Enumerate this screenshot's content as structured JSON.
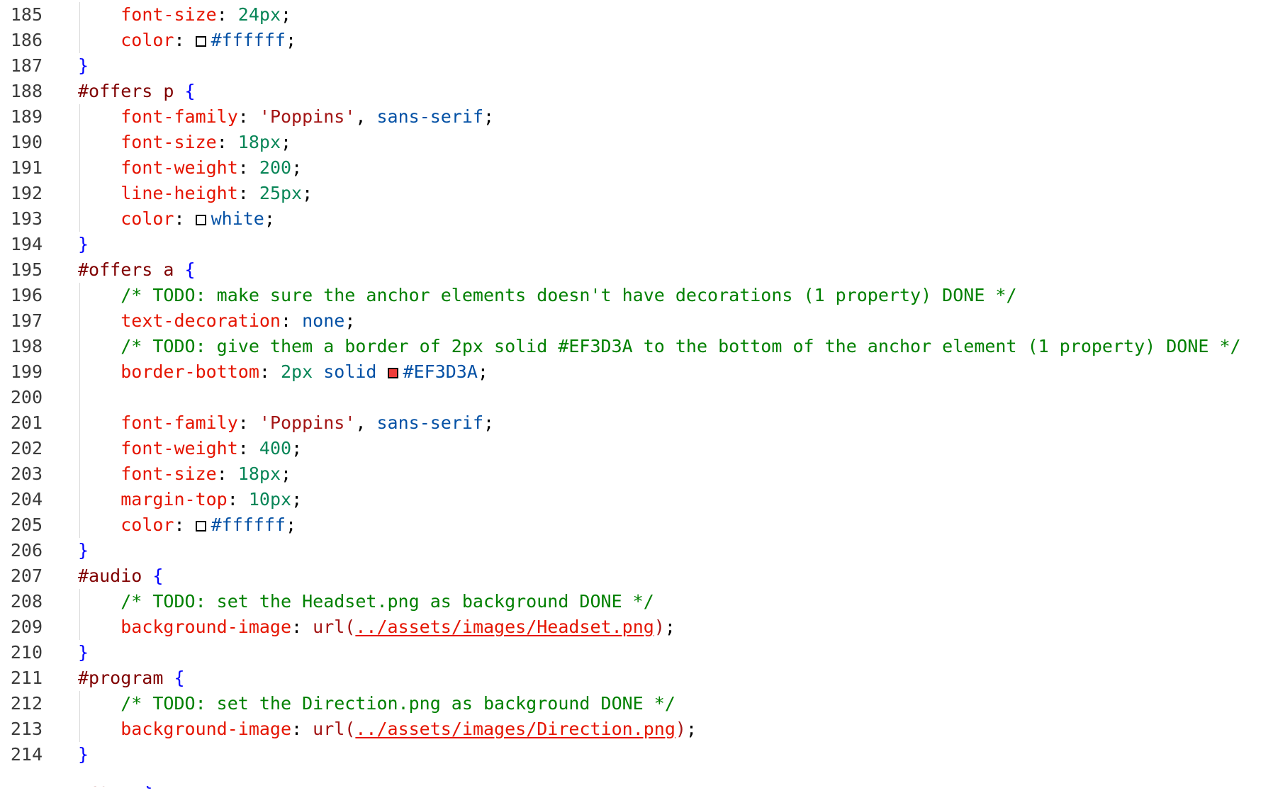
{
  "editor": {
    "lines": [
      {
        "number": "185",
        "indent": "    ",
        "tokens": [
          {
            "t": "font-size",
            "c": "prop"
          },
          {
            "t": ": ",
            "c": "punc"
          },
          {
            "t": "24px",
            "c": "num"
          },
          {
            "t": ";",
            "c": "punc"
          }
        ]
      },
      {
        "number": "186",
        "indent": "    ",
        "tokens": [
          {
            "t": "color",
            "c": "prop"
          },
          {
            "t": ": ",
            "c": "punc"
          },
          {
            "swatch": "#ffffff",
            "c": "swatch"
          },
          {
            "t": "#ffffff",
            "c": "kw"
          },
          {
            "t": ";",
            "c": "punc"
          }
        ]
      },
      {
        "number": "187",
        "indent": "",
        "tokens": [
          {
            "t": "}",
            "c": "brace"
          }
        ]
      },
      {
        "number": "188",
        "indent": "",
        "tokens": [
          {
            "t": "#offers p ",
            "c": "sel"
          },
          {
            "t": "{",
            "c": "brace"
          }
        ]
      },
      {
        "number": "189",
        "indent": "    ",
        "tokens": [
          {
            "t": "font-family",
            "c": "prop"
          },
          {
            "t": ": ",
            "c": "punc"
          },
          {
            "t": "'Poppins'",
            "c": "str"
          },
          {
            "t": ", ",
            "c": "punc"
          },
          {
            "t": "sans-serif",
            "c": "kw"
          },
          {
            "t": ";",
            "c": "punc"
          }
        ]
      },
      {
        "number": "190",
        "indent": "    ",
        "tokens": [
          {
            "t": "font-size",
            "c": "prop"
          },
          {
            "t": ": ",
            "c": "punc"
          },
          {
            "t": "18px",
            "c": "num"
          },
          {
            "t": ";",
            "c": "punc"
          }
        ]
      },
      {
        "number": "191",
        "indent": "    ",
        "tokens": [
          {
            "t": "font-weight",
            "c": "prop"
          },
          {
            "t": ": ",
            "c": "punc"
          },
          {
            "t": "200",
            "c": "num"
          },
          {
            "t": ";",
            "c": "punc"
          }
        ]
      },
      {
        "number": "192",
        "indent": "    ",
        "tokens": [
          {
            "t": "line-height",
            "c": "prop"
          },
          {
            "t": ": ",
            "c": "punc"
          },
          {
            "t": "25px",
            "c": "num"
          },
          {
            "t": ";",
            "c": "punc"
          }
        ]
      },
      {
        "number": "193",
        "indent": "    ",
        "tokens": [
          {
            "t": "color",
            "c": "prop"
          },
          {
            "t": ": ",
            "c": "punc"
          },
          {
            "swatch": "#ffffff",
            "c": "swatch"
          },
          {
            "t": "white",
            "c": "kw"
          },
          {
            "t": ";",
            "c": "punc"
          }
        ]
      },
      {
        "number": "194",
        "indent": "",
        "tokens": [
          {
            "t": "}",
            "c": "brace"
          }
        ]
      },
      {
        "number": "195",
        "indent": "",
        "tokens": [
          {
            "t": "#offers a ",
            "c": "sel"
          },
          {
            "t": "{",
            "c": "brace"
          }
        ]
      },
      {
        "number": "196",
        "indent": "    ",
        "tokens": [
          {
            "t": "/* TODO: make sure the anchor elements doesn't have decorations (1 property) DONE */",
            "c": "com"
          }
        ]
      },
      {
        "number": "197",
        "indent": "    ",
        "tokens": [
          {
            "t": "text-decoration",
            "c": "prop"
          },
          {
            "t": ": ",
            "c": "punc"
          },
          {
            "t": "none",
            "c": "kw"
          },
          {
            "t": ";",
            "c": "punc"
          }
        ]
      },
      {
        "number": "198",
        "indent": "    ",
        "tokens": [
          {
            "t": "/* TODO: give them a border of 2px solid #EF3D3A to the bottom of the anchor element (1 property) DONE */",
            "c": "com"
          }
        ]
      },
      {
        "number": "199",
        "indent": "    ",
        "tokens": [
          {
            "t": "border-bottom",
            "c": "prop"
          },
          {
            "t": ": ",
            "c": "punc"
          },
          {
            "t": "2px",
            "c": "num"
          },
          {
            "t": " ",
            "c": "punc"
          },
          {
            "t": "solid",
            "c": "kw"
          },
          {
            "t": " ",
            "c": "punc"
          },
          {
            "swatch": "#EF3D3A",
            "c": "swatch"
          },
          {
            "t": "#EF3D3A",
            "c": "kw"
          },
          {
            "t": ";",
            "c": "punc"
          }
        ]
      },
      {
        "number": "200",
        "indent": "    ",
        "tokens": []
      },
      {
        "number": "201",
        "indent": "    ",
        "tokens": [
          {
            "t": "font-family",
            "c": "prop"
          },
          {
            "t": ": ",
            "c": "punc"
          },
          {
            "t": "'Poppins'",
            "c": "str"
          },
          {
            "t": ", ",
            "c": "punc"
          },
          {
            "t": "sans-serif",
            "c": "kw"
          },
          {
            "t": ";",
            "c": "punc"
          }
        ]
      },
      {
        "number": "202",
        "indent": "    ",
        "tokens": [
          {
            "t": "font-weight",
            "c": "prop"
          },
          {
            "t": ": ",
            "c": "punc"
          },
          {
            "t": "400",
            "c": "num"
          },
          {
            "t": ";",
            "c": "punc"
          }
        ]
      },
      {
        "number": "203",
        "indent": "    ",
        "tokens": [
          {
            "t": "font-size",
            "c": "prop"
          },
          {
            "t": ": ",
            "c": "punc"
          },
          {
            "t": "18px",
            "c": "num"
          },
          {
            "t": ";",
            "c": "punc"
          }
        ]
      },
      {
        "number": "204",
        "indent": "    ",
        "tokens": [
          {
            "t": "margin-top",
            "c": "prop"
          },
          {
            "t": ": ",
            "c": "punc"
          },
          {
            "t": "10px",
            "c": "num"
          },
          {
            "t": ";",
            "c": "punc"
          }
        ]
      },
      {
        "number": "205",
        "indent": "    ",
        "tokens": [
          {
            "t": "color",
            "c": "prop"
          },
          {
            "t": ": ",
            "c": "punc"
          },
          {
            "swatch": "#ffffff",
            "c": "swatch"
          },
          {
            "t": "#ffffff",
            "c": "kw"
          },
          {
            "t": ";",
            "c": "punc"
          }
        ]
      },
      {
        "number": "206",
        "indent": "",
        "tokens": [
          {
            "t": "}",
            "c": "brace"
          }
        ]
      },
      {
        "number": "207",
        "indent": "",
        "tokens": [
          {
            "t": "#audio ",
            "c": "sel"
          },
          {
            "t": "{",
            "c": "brace"
          }
        ]
      },
      {
        "number": "208",
        "indent": "    ",
        "tokens": [
          {
            "t": "/* TODO: set the Headset.png as background DONE */",
            "c": "com"
          }
        ]
      },
      {
        "number": "209",
        "indent": "    ",
        "tokens": [
          {
            "t": "background-image",
            "c": "prop"
          },
          {
            "t": ": ",
            "c": "punc"
          },
          {
            "t": "url(",
            "c": "url"
          },
          {
            "t": "../assets/images/Headset.png",
            "c": "url-text"
          },
          {
            "t": ")",
            "c": "url"
          },
          {
            "t": ";",
            "c": "punc"
          }
        ]
      },
      {
        "number": "210",
        "indent": "",
        "tokens": [
          {
            "t": "}",
            "c": "brace"
          }
        ]
      },
      {
        "number": "211",
        "indent": "",
        "tokens": [
          {
            "t": "#program ",
            "c": "sel"
          },
          {
            "t": "{",
            "c": "brace"
          }
        ]
      },
      {
        "number": "212",
        "indent": "    ",
        "tokens": [
          {
            "t": "/* TODO: set the Direction.png as background DONE */",
            "c": "com"
          }
        ]
      },
      {
        "number": "213",
        "indent": "    ",
        "tokens": [
          {
            "t": "background-image",
            "c": "prop"
          },
          {
            "t": ": ",
            "c": "punc"
          },
          {
            "t": "url(",
            "c": "url"
          },
          {
            "t": "../assets/images/Direction.png",
            "c": "url-text"
          },
          {
            "t": ")",
            "c": "url"
          },
          {
            "t": ";",
            "c": "punc"
          }
        ]
      },
      {
        "number": "214",
        "indent": "",
        "tokens": [
          {
            "t": "}",
            "c": "brace"
          }
        ]
      },
      {
        "number": "",
        "indent": "",
        "partial": true,
        "tokens": [
          {
            "t": "#cart ",
            "c": "sel"
          },
          {
            "t": "{",
            "c": "brace"
          }
        ]
      }
    ],
    "colors": {
      "selector": "#800000",
      "brace": "#0000ff",
      "property": "#e51400",
      "number": "#098658",
      "string": "#a31515",
      "keyword": "#0451a5",
      "comment": "#008000",
      "line_number": "#3c3c3c",
      "indent_guide": "#d8d8d8"
    }
  }
}
